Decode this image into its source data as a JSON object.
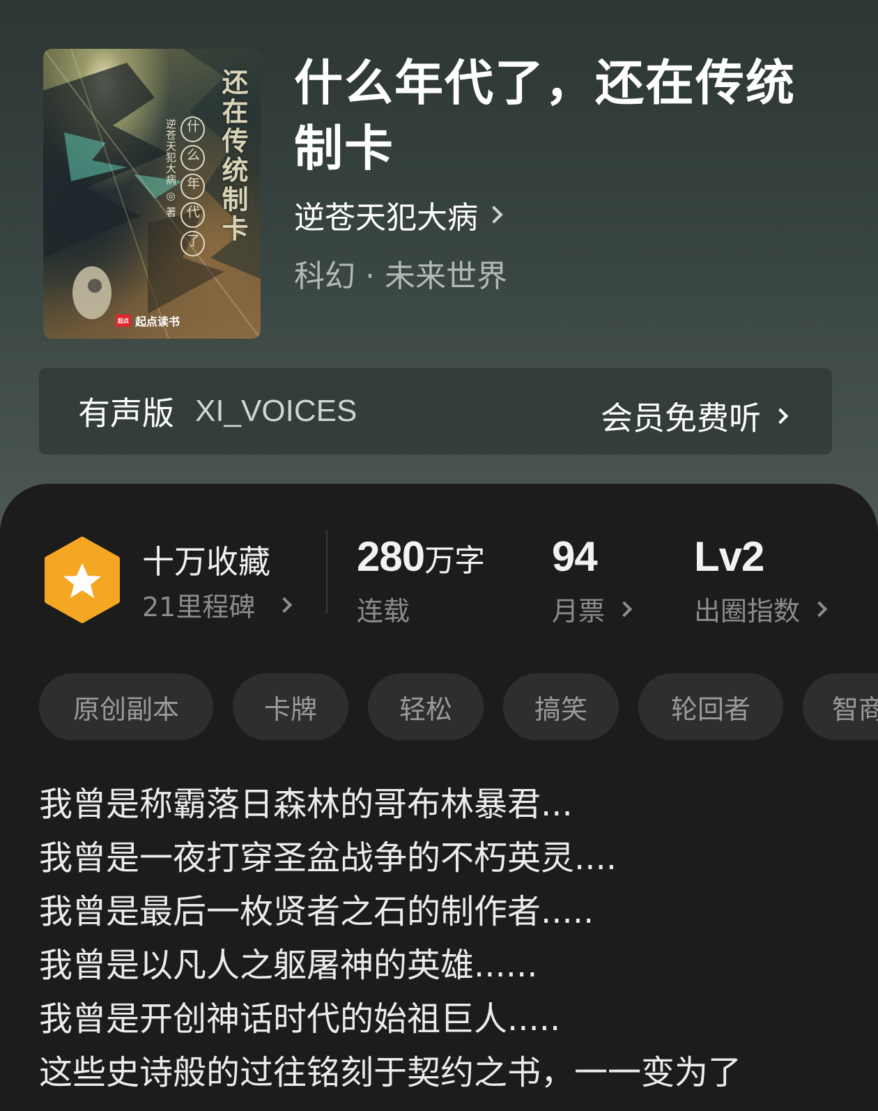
{
  "book": {
    "title": "什么年代了，还在传统制卡",
    "author": "逆苍天犯大病",
    "genre": "科幻 · 未来世界"
  },
  "cover": {
    "title": "还在传统制卡",
    "subtitle": [
      "什",
      "么",
      "年",
      "代",
      "了"
    ],
    "author": "逆苍天犯大病 ◎ 著",
    "publisher_badge": "起点",
    "publisher": "起点读书"
  },
  "audio": {
    "label": "有声版",
    "voice": "XI_VOICES",
    "action": "会员免费听"
  },
  "stats": {
    "collect": "十万收藏",
    "milestone": "21里程碑",
    "words_num": "280",
    "words_unit": "万字",
    "status": "连载",
    "votes": "94",
    "votes_label": "月票",
    "level": "Lv2",
    "level_label": "出圈指数"
  },
  "tags": [
    "原创副本",
    "卡牌",
    "轻松",
    "搞笑",
    "轮回者",
    "智商"
  ],
  "description": [
    "我曾是称霸落日森林的哥布林暴君...",
    "我曾是一夜打穿圣盆战争的不朽英灵....",
    "我曾是最后一枚贤者之石的制作者.....",
    "我曾是以凡人之躯屠神的英雄......",
    "我曾是开创神话时代的始祖巨人.....",
    "这些史诗般的过往铭刻于契约之书，一一变为了"
  ],
  "colors": {
    "header_bg": "#3a4643",
    "panel_bg": "#1c1c1c",
    "tag_bg": "#2e2e2e",
    "badge_orange": "#f5a623"
  }
}
